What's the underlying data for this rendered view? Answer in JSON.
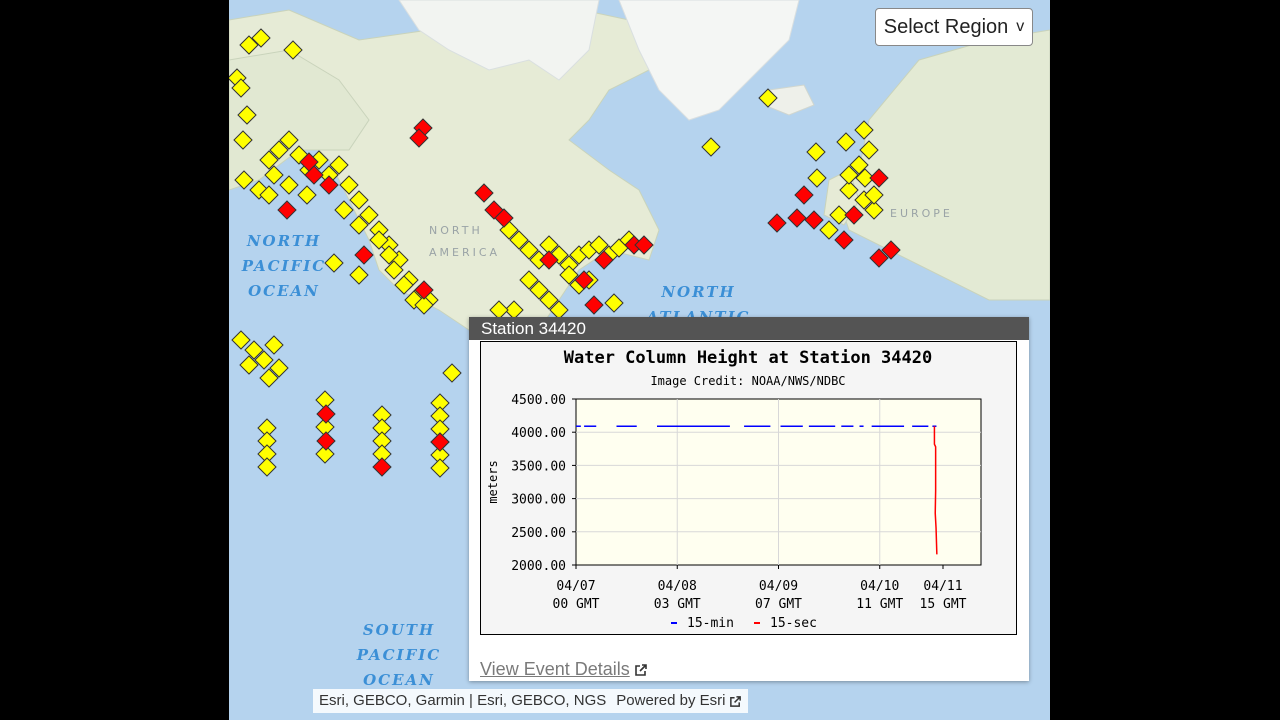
{
  "map": {
    "region_select": {
      "label": "Select Region",
      "chevron": "v"
    },
    "ocean_labels": [
      {
        "id": "north-pacific",
        "lines": [
          "NORTH",
          "PACIFIC",
          "OCEAN"
        ]
      },
      {
        "id": "north-atlantic",
        "lines": [
          "NORTH",
          "ATLANTIC"
        ]
      },
      {
        "id": "south-pacific",
        "lines": [
          "SOUTH",
          "PACIFIC",
          "OCEAN"
        ]
      }
    ],
    "land_labels": [
      {
        "id": "north-america",
        "lines": [
          "NORTH",
          "AMERICA"
        ]
      },
      {
        "id": "europe",
        "lines": [
          "EUROPE"
        ]
      }
    ],
    "marker_colors": {
      "normal": "#ffff00",
      "event": "#ff0000",
      "stroke": "#333333"
    },
    "attribution": {
      "sources": "Esri, GEBCO, Garmin | Esri, GEBCO, NGS",
      "powered_by": "Powered by Esri",
      "external_icon": "external-link-icon"
    }
  },
  "popup": {
    "title": "Station 34420",
    "details_link": "View Event Details",
    "details_icon": "external-link-icon"
  },
  "chart_data": {
    "type": "line",
    "title": "Water Column Height at Station 34420",
    "subtitle": "Image Credit: NOAA/NWS/NDBC",
    "ylabel": "meters",
    "xlabel": "",
    "ylim": [
      2000,
      4500
    ],
    "y_ticks": [
      "4500.00",
      "4000.00",
      "3500.00",
      "3000.00",
      "2500.00",
      "2000.00"
    ],
    "x_ticks": [
      {
        "line1": "04/07",
        "line2": "00 GMT"
      },
      {
        "line1": "04/08",
        "line2": "03 GMT"
      },
      {
        "line1": "04/09",
        "line2": "07 GMT"
      },
      {
        "line1": "04/10",
        "line2": "11 GMT"
      },
      {
        "line1": "04/11",
        "line2": "15 GMT"
      }
    ],
    "series": [
      {
        "name": "15-min",
        "color": "#0000ff",
        "segments": [
          {
            "from": 0.0,
            "to": 0.012,
            "value": 4090
          },
          {
            "from": 0.02,
            "to": 0.05,
            "value": 4090
          },
          {
            "from": 0.1,
            "to": 0.15,
            "value": 4090
          },
          {
            "from": 0.2,
            "to": 0.38,
            "value": 4090
          },
          {
            "from": 0.415,
            "to": 0.48,
            "value": 4090
          },
          {
            "from": 0.505,
            "to": 0.56,
            "value": 4090
          },
          {
            "from": 0.575,
            "to": 0.64,
            "value": 4090
          },
          {
            "from": 0.655,
            "to": 0.685,
            "value": 4090
          },
          {
            "from": 0.7,
            "to": 0.71,
            "value": 4090
          },
          {
            "from": 0.73,
            "to": 0.81,
            "value": 4090
          },
          {
            "from": 0.83,
            "to": 0.87,
            "value": 4090
          },
          {
            "from": 0.88,
            "to": 0.89,
            "value": 4090
          }
        ]
      },
      {
        "name": "15-sec",
        "color": "#ff0000",
        "points": [
          {
            "x": 0.885,
            "y": 4090
          },
          {
            "x": 0.885,
            "y": 3820
          },
          {
            "x": 0.888,
            "y": 3780
          },
          {
            "x": 0.888,
            "y": 3120
          },
          {
            "x": 0.887,
            "y": 2780
          },
          {
            "x": 0.889,
            "y": 2560
          },
          {
            "x": 0.891,
            "y": 2160
          }
        ]
      }
    ],
    "legend": "bottom"
  }
}
